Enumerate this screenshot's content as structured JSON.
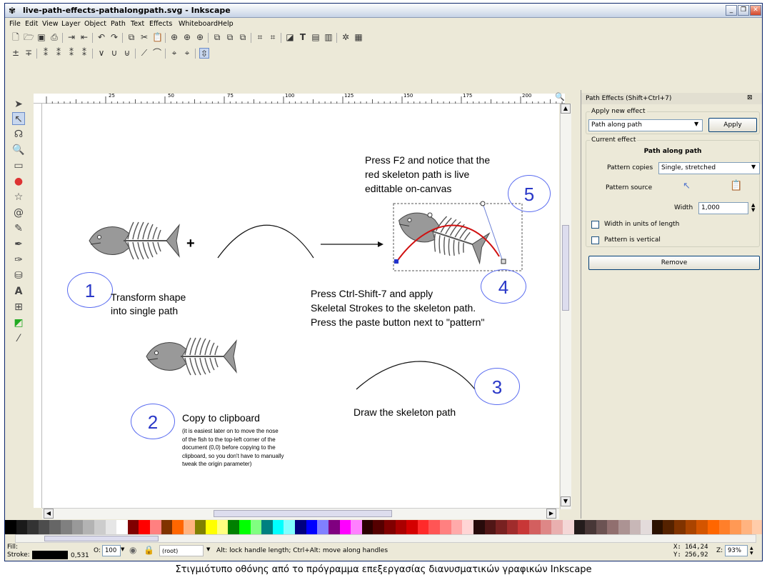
{
  "window": {
    "title": "live-path-effects-pathalongpath.svg - Inkscape"
  },
  "menu": [
    "File",
    "Edit",
    "View",
    "Layer",
    "Object",
    "Path",
    "Text",
    "Effects",
    "Whiteboard",
    "Help"
  ],
  "panel": {
    "title": "Path Effects (Shift+Ctrl+7)",
    "apply_group": "Apply new effect",
    "effect_select": "Path along path",
    "apply_button": "Apply",
    "current_group": "Current effect",
    "current_effect": "Path along path",
    "pattern_copies_label": "Pattern copies",
    "pattern_copies_value": "Single, stretched",
    "pattern_source_label": "Pattern source",
    "width_label": "Width",
    "width_value": "1,000",
    "width_units_label": "Width in units of length",
    "vertical_label": "Pattern is vertical",
    "remove_button": "Remove"
  },
  "canvas": {
    "step1": "Transform shape\ninto single path",
    "step2_title": "Copy to clipboard",
    "step2_note": "(it is easiest later on to move the nose\nof the fish to the top-left corner of the\ndocument (0,0) before copying to the\nclipboard, so you don't have to manually\ntweak the origin parameter)",
    "step3": "Draw the skeleton path",
    "step4": "Press Ctrl-Shift-7 and apply\nSkeletal Strokes to the skeleton path.\nPress the paste button next to \"pattern\"",
    "step5": "Press F2 and notice that the\nred skeleton path is live\nedittable on-canvas",
    "plus": "+",
    "numbers": [
      "1",
      "2",
      "3",
      "4",
      "5"
    ]
  },
  "status": {
    "fill_label": "Fill:",
    "stroke_label": "Stroke:",
    "stroke_width": "0,531",
    "opacity_label": "O:",
    "opacity_value": "100",
    "layer": "(root)",
    "message": "Alt: lock handle length; Ctrl+Alt: move along handles",
    "x_label": "X:",
    "x_value": "164,24",
    "y_label": "Y:",
    "y_value": "256,92",
    "zoom_label": "Z:",
    "zoom_value": "93%"
  },
  "ruler_labels": [
    "25",
    "50",
    "75",
    "100",
    "125",
    "150",
    "175",
    "200"
  ],
  "caption": "Στιγμιότυπο οθόνης από το πρόγραμμα επεξεργασίας διανυσματικών γραφικών Inkscape"
}
